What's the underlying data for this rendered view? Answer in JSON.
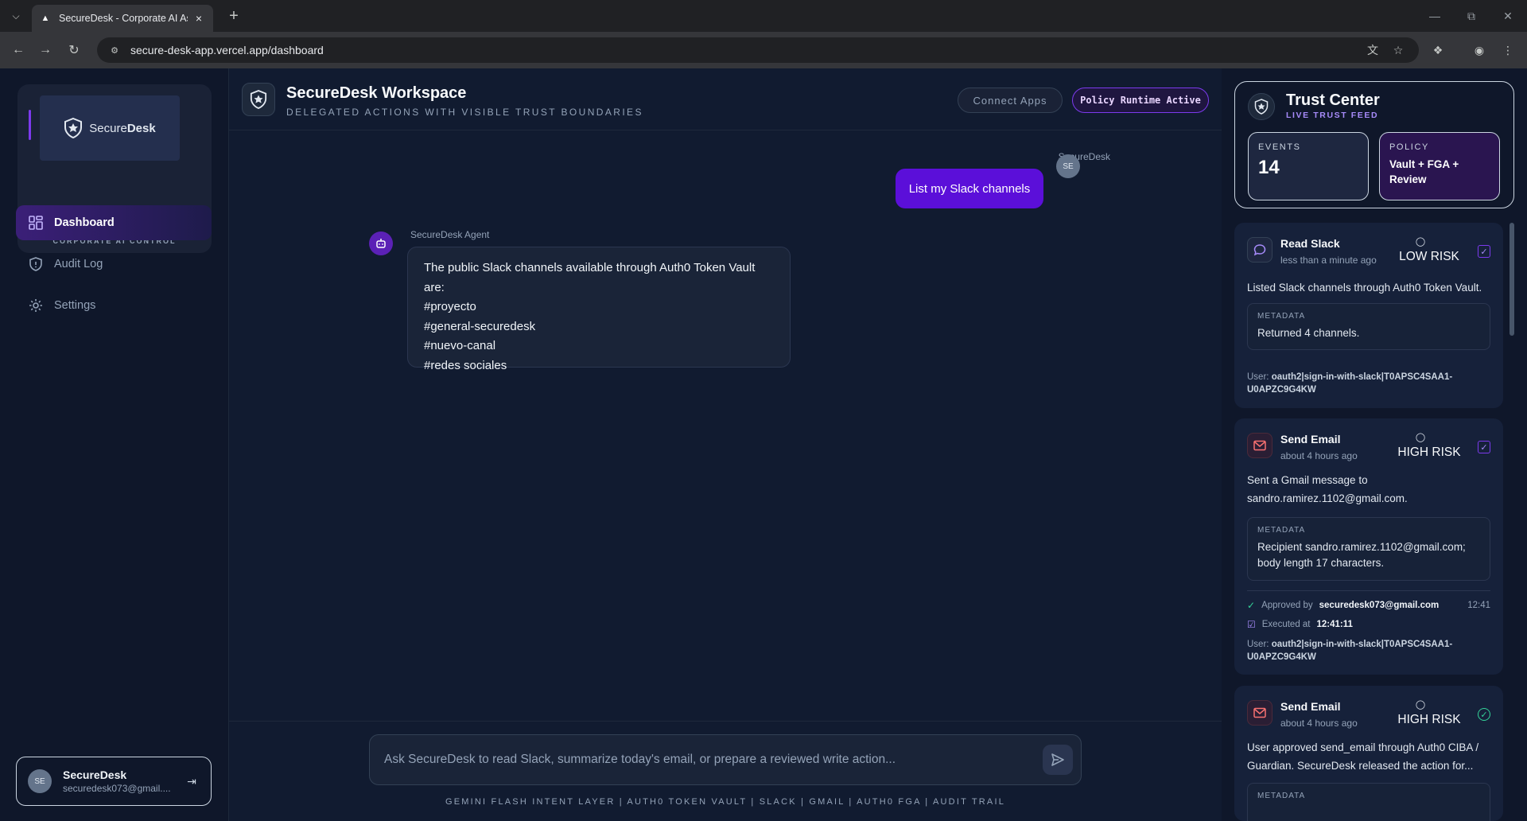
{
  "browser": {
    "tab_title": "SecureDesk - Corporate AI Assi",
    "url": "secure-desk-app.vercel.app/dashboard"
  },
  "sidebar": {
    "brand_primary": "Secure",
    "brand_secondary": "Desk",
    "tagline": "CORPORATE AI CONTROL",
    "items": [
      {
        "label": "Dashboard",
        "icon": "grid-icon",
        "active": true
      },
      {
        "label": "Audit Log",
        "icon": "shield-icon",
        "active": false
      },
      {
        "label": "Settings",
        "icon": "gear-icon",
        "active": false
      }
    ],
    "user": {
      "initials": "SE",
      "name": "SecureDesk",
      "email": "securedesk073@gmail...."
    }
  },
  "header": {
    "title": "SecureDesk Workspace",
    "subtitle": "DELEGATED ACTIONS WITH VISIBLE TRUST BOUNDARIES",
    "connect_label": "Connect Apps",
    "policy_label": "Policy Runtime Active"
  },
  "chat": {
    "user_message": {
      "sender": "SecureDesk",
      "initials": "SE",
      "text": "List my Slack channels"
    },
    "agent_message": {
      "sender": "SecureDesk Agent",
      "lines": [
        "The public Slack channels available through Auth0 Token Vault are:",
        "#proyecto",
        "#general-securedesk",
        "#nuevo-canal",
        "#redes sociales"
      ]
    }
  },
  "composer": {
    "placeholder": "Ask SecureDesk to read Slack, summarize today's email, or prepare a reviewed write action...",
    "footer": "GEMINI FLASH INTENT LAYER | AUTH0 TOKEN VAULT | SLACK | GMAIL | AUTH0 FGA | AUDIT TRAIL"
  },
  "trust_center": {
    "title": "Trust Center",
    "subtitle": "LIVE TRUST FEED",
    "events_label": "EVENTS",
    "events_value": "14",
    "policy_label": "POLICY",
    "policy_value": "Vault + FGA + Review",
    "events": [
      {
        "title": "Read Slack",
        "time": "less than a minute ago",
        "risk": "LOW RISK",
        "description": "Listed Slack channels through Auth0 Token Vault.",
        "meta_label": "METADATA",
        "meta_text": "Returned 4 channels.",
        "user_label": "User:",
        "user_id": "oauth2|sign-in-with-slack|T0APSC4SAA1-U0APZC9G4KW"
      },
      {
        "title": "Send Email",
        "time": "about 4 hours ago",
        "risk": "HIGH RISK",
        "description": "Sent a Gmail message to sandro.ramirez.1102@gmail.com.",
        "meta_label": "METADATA",
        "meta_text": "Recipient sandro.ramirez.1102@gmail.com; body length 17 characters.",
        "approved_prefix": "Approved by",
        "approved_by": "securedesk073@gmail.com",
        "approved_time": "12:41",
        "executed_prefix": "Executed at",
        "executed_at": "12:41:11",
        "user_label": "User:",
        "user_id": "oauth2|sign-in-with-slack|T0APSC4SAA1-U0APZC9G4KW"
      },
      {
        "title": "Send Email",
        "time": "about 4 hours ago",
        "risk": "HIGH RISK",
        "description": "User approved send_email through Auth0 CIBA / Guardian. SecureDesk released the action for...",
        "meta_label": "METADATA"
      }
    ]
  },
  "colors": {
    "accent": "#5b0fd9",
    "background": "#0f172a",
    "panel": "#16213a"
  }
}
